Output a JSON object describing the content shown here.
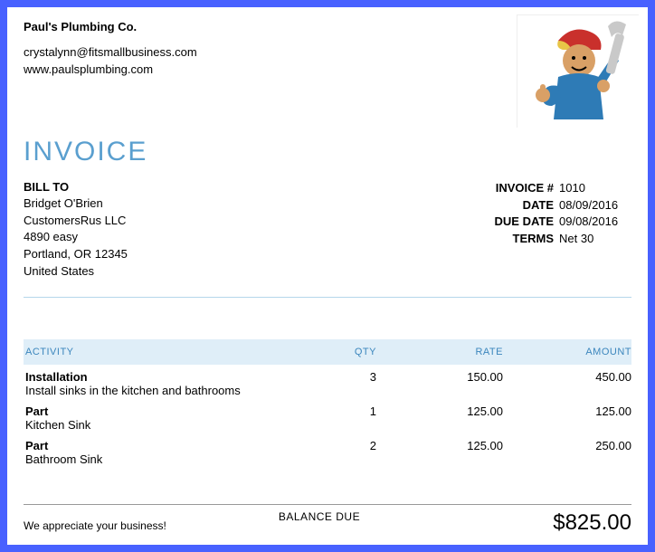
{
  "company": {
    "name": "Paul's Plumbing Co.",
    "email": "crystalynn@fitsmallbusiness.com",
    "website": "www.paulsplumbing.com"
  },
  "title": "INVOICE",
  "billto": {
    "label": "BILL TO",
    "name": "Bridget O'Brien",
    "company": "CustomersRus LLC",
    "street": "4890 easy",
    "citystate": "Portland, OR  12345",
    "country": "United States"
  },
  "meta": {
    "invoice_label": "INVOICE #",
    "invoice_value": "1010",
    "date_label": "DATE",
    "date_value": "08/09/2016",
    "due_label": "DUE DATE",
    "due_value": "09/08/2016",
    "terms_label": "TERMS",
    "terms_value": "Net 30"
  },
  "columns": {
    "activity": "ACTIVITY",
    "qty": "QTY",
    "rate": "RATE",
    "amount": "AMOUNT"
  },
  "lines": [
    {
      "name": "Installation",
      "desc": "Install sinks in the kitchen and bathrooms",
      "qty": "3",
      "rate": "150.00",
      "amount": "450.00"
    },
    {
      "name": "Part",
      "desc": "Kitchen Sink",
      "qty": "1",
      "rate": "125.00",
      "amount": "125.00"
    },
    {
      "name": "Part",
      "desc": "Bathroom Sink",
      "qty": "2",
      "rate": "125.00",
      "amount": "250.00"
    }
  ],
  "footer": {
    "note": "We appreciate your business!",
    "balance_label": "BALANCE DUE",
    "amount_due": "$825.00"
  }
}
